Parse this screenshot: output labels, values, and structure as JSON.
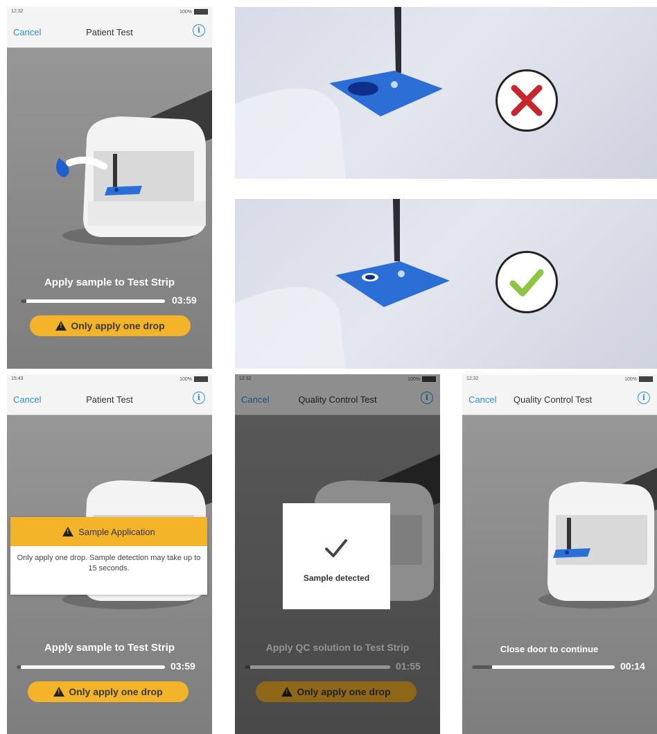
{
  "screens": {
    "patient_test_1": {
      "status_time": "12:32",
      "status_battery": "100%",
      "nav_cancel": "Cancel",
      "nav_title": "Patient Test",
      "prompt": "Apply sample to Test Strip",
      "progress": 0.96,
      "timer": "03:59",
      "warning_button": "Only apply one drop"
    },
    "patient_test_2": {
      "status_time": "15:43",
      "status_battery": "100%",
      "nav_cancel": "Cancel",
      "nav_title": "Patient Test",
      "popup_title": "Sample Application",
      "popup_body": "Only apply one drop.  Sample detection may take up to 15 seconds.",
      "prompt": "Apply sample to Test Strip",
      "progress": 0.97,
      "timer": "03:59",
      "warning_button": "Only apply one drop"
    },
    "qc_test_1": {
      "status_time": "12:32",
      "status_battery": "100%",
      "nav_cancel": "Cancel",
      "nav_title": "Quality Control Test",
      "detected_label": "Sample detected",
      "prompt": "Apply QC solution to Test Strip",
      "progress": 0.96,
      "timer": "01:55",
      "warning_button": "Only apply one drop"
    },
    "qc_test_2": {
      "status_time": "12:32",
      "status_battery": "100%",
      "nav_cancel": "Cancel",
      "nav_title": "Quality Control Test",
      "prompt": "Close door to continue",
      "progress": 0.86,
      "timer": "00:14"
    }
  },
  "photos": {
    "incorrect": {
      "mark_icon": "cross-icon",
      "mark_color": "#c8262c"
    },
    "correct": {
      "mark_icon": "check-icon",
      "mark_color": "#8cc63f"
    }
  },
  "colors": {
    "accent": "#2f8fd8",
    "warning": "#f4b42a",
    "strip": "#2b6fd6"
  }
}
